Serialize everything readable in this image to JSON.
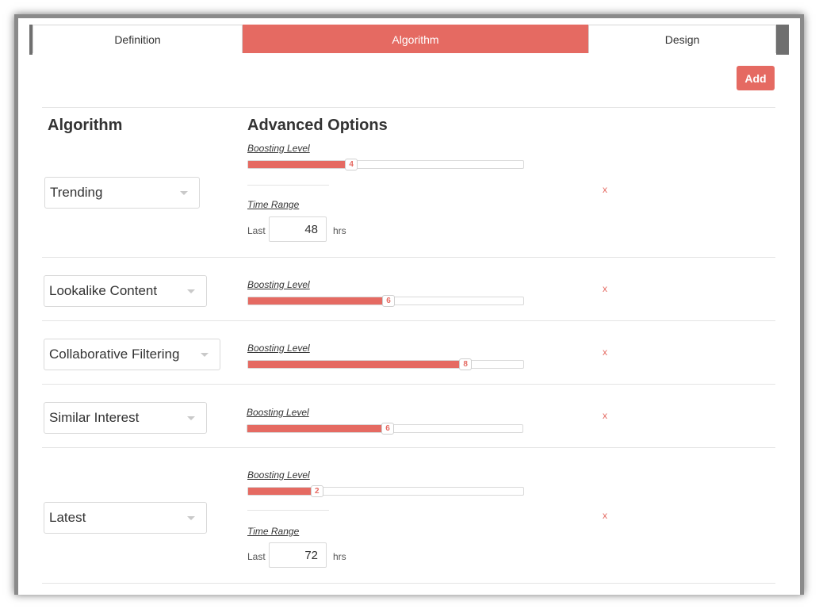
{
  "tabs": [
    {
      "label": "Definition",
      "active": false
    },
    {
      "label": "Algorithm",
      "active": true
    },
    {
      "label": "Design",
      "active": false
    }
  ],
  "add_label": "Add",
  "columns": {
    "algorithm": "Algorithm",
    "advanced": "Advanced Options"
  },
  "colors": {
    "accent": "#e56a62"
  },
  "rows": [
    {
      "algorithm": "Trending",
      "boosting_label": "Boosting Level",
      "boosting_value": "4",
      "boosting_fraction": 0.375,
      "time_range_label": "Time Range",
      "last_label": "Last",
      "hours": "48",
      "hrs_label": "hrs",
      "remove": "x"
    },
    {
      "algorithm": "Lookalike Content",
      "boosting_label": "Boosting Level",
      "boosting_value": "6",
      "boosting_fraction": 0.51,
      "remove": "x"
    },
    {
      "algorithm": "Collaborative Filtering",
      "boosting_label": "Boosting Level",
      "boosting_value": "8",
      "boosting_fraction": 0.79,
      "remove": "x"
    },
    {
      "algorithm": "Similar Interest",
      "boosting_label": "Boosting Level",
      "boosting_value": "6",
      "boosting_fraction": 0.51,
      "remove": "x"
    },
    {
      "algorithm": "Latest",
      "boosting_label": "Boosting Level",
      "boosting_value": "2",
      "boosting_fraction": 0.25,
      "time_range_label": "Time Range",
      "last_label": "Last",
      "hours": "72",
      "hrs_label": "hrs",
      "remove": "x"
    }
  ]
}
